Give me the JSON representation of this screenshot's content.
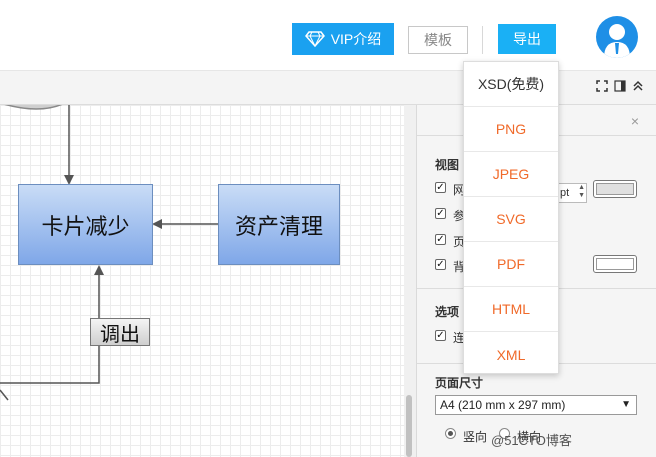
{
  "header": {
    "vip_label": "VIP介绍",
    "template_label": "模板",
    "export_label": "导出"
  },
  "canvas": {
    "node_left": "卡片减少",
    "node_right": "资产清理",
    "edge_label": "调出"
  },
  "export_menu": {
    "items": [
      "XSD(免费)",
      "PNG",
      "JPEG",
      "SVG",
      "PDF",
      "HTML",
      "XML"
    ]
  },
  "panel": {
    "close_icon": "×",
    "view_heading": "视图",
    "view_items": [
      "网",
      "参",
      "页",
      "背"
    ],
    "spinner_value": "pt",
    "options_heading": "选项",
    "options_items": [
      "连"
    ],
    "page_size_heading": "页面尺寸",
    "page_size_value": "A4 (210 mm x 297 mm)",
    "orientation_portrait": "竖向",
    "orientation_landscape": "横向"
  },
  "watermark": "@51CTO博客",
  "colors": {
    "accent": "#1aa1f0",
    "export_menu_text": "#f06a2a",
    "node_border": "#6c8ebf"
  }
}
